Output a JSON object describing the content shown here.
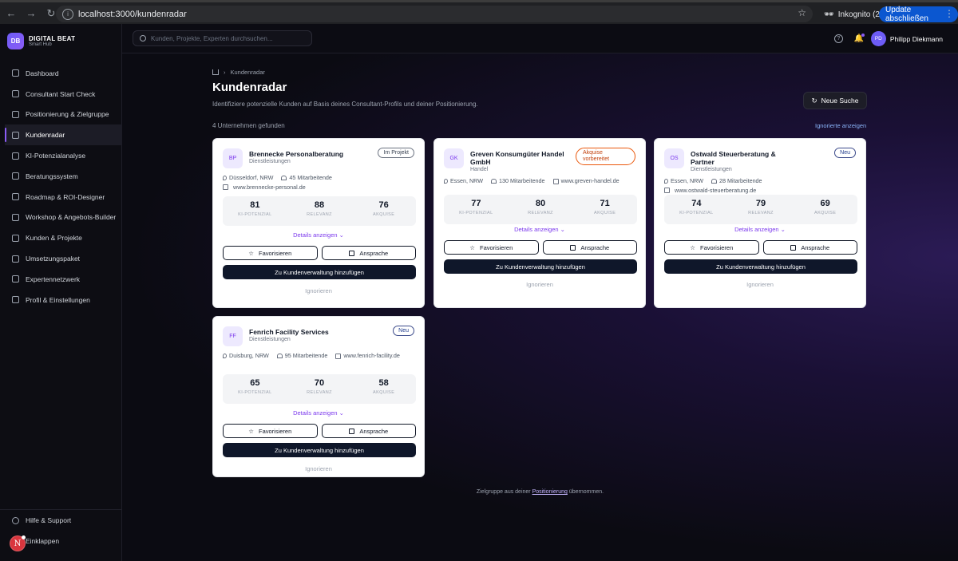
{
  "browser": {
    "url": "localhost:3000/kundenradar",
    "incognito_label": "Inkognito (2)",
    "update_label": "Update abschließen"
  },
  "brand": {
    "initials": "DB",
    "name": "DIGITAL BEAT",
    "tagline": "Smart Hub"
  },
  "sidebar": {
    "items": [
      {
        "label": "Dashboard",
        "icon": "dashboard-icon"
      },
      {
        "label": "Consultant Start Check",
        "icon": "clipboard-icon"
      },
      {
        "label": "Positionierung & Zielgruppe",
        "icon": "target-icon"
      },
      {
        "label": "Kundenradar",
        "icon": "radar-icon",
        "active": true
      },
      {
        "label": "KI-Potenzialanalyse",
        "icon": "sparkles-icon"
      },
      {
        "label": "Beratungssystem",
        "icon": "workflow-icon"
      },
      {
        "label": "Roadmap & ROI-Designer",
        "icon": "trending-up-icon"
      },
      {
        "label": "Workshop & Angebots-Builder",
        "icon": "monitor-icon"
      },
      {
        "label": "Kunden & Projekte",
        "icon": "users-icon"
      },
      {
        "label": "Umsetzungspaket",
        "icon": "package-icon"
      },
      {
        "label": "Expertennetzwerk",
        "icon": "network-icon"
      },
      {
        "label": "Profil & Einstellungen",
        "icon": "user-circle-icon"
      }
    ],
    "help": "Hilfe & Support",
    "collapse": "Einklappen",
    "dev_badge": "N"
  },
  "topbar": {
    "search_placeholder": "Kunden, Projekte, Experten durchsuchen...",
    "user_initials": "PD",
    "user_name": "Philipp Diekmann"
  },
  "page": {
    "breadcrumb": "Kundenradar",
    "title": "Kundenradar",
    "subtitle": "Identifiziere potenzielle Kunden auf Basis deines Consultant-Profils und deiner Positionierung.",
    "new_search": "Neue Suche",
    "result_count": "4 Unternehmen gefunden",
    "show_ignored": "Ignorierte anzeigen",
    "footnote_pre": "Zielgruppe aus deiner ",
    "footnote_link": "Positionierung",
    "footnote_post": " übernommen."
  },
  "labels": {
    "ki": "KI-POTENZIAL",
    "rel": "RELEVANZ",
    "akq": "AKQUISE",
    "details": "Details anzeigen",
    "fav": "Favorisieren",
    "contact": "Ansprache",
    "add": "Zu Kundenverwaltung hinzufügen",
    "ignore": "Ignorieren"
  },
  "companies": [
    {
      "initials": "BP",
      "name": "Brennecke Personalberatung",
      "industry": "Dienstleistungen",
      "badge": "Im Projekt",
      "location": "Düsseldorf, NRW",
      "employees": "45 Mitarbeitende",
      "website": "www.brennecke-personal.de",
      "ki": "81",
      "rel": "88",
      "akq": "76"
    },
    {
      "initials": "GK",
      "name": "Greven Konsumgüter Handel GmbH",
      "industry": "Handel",
      "badge": "Akquise vorbereitet",
      "location": "Essen, NRW",
      "employees": "130 Mitarbeitende",
      "website": "www.greven-handel.de",
      "ki": "77",
      "rel": "80",
      "akq": "71"
    },
    {
      "initials": "OS",
      "name": "Ostwald Steuerberatung & Partner",
      "industry": "Dienstleistungen",
      "badge": "Neu",
      "location": "Essen, NRW",
      "employees": "28 Mitarbeitende",
      "website": "www.ostwald-steuerberatung.de",
      "ki": "74",
      "rel": "79",
      "akq": "69"
    },
    {
      "initials": "FF",
      "name": "Fenrich Facility Services",
      "industry": "Dienstleistungen",
      "badge": "Neu",
      "location": "Duisburg, NRW",
      "employees": "95 Mitarbeitende",
      "website": "www.fenrich-facility.de",
      "ki": "65",
      "rel": "70",
      "akq": "58"
    }
  ]
}
